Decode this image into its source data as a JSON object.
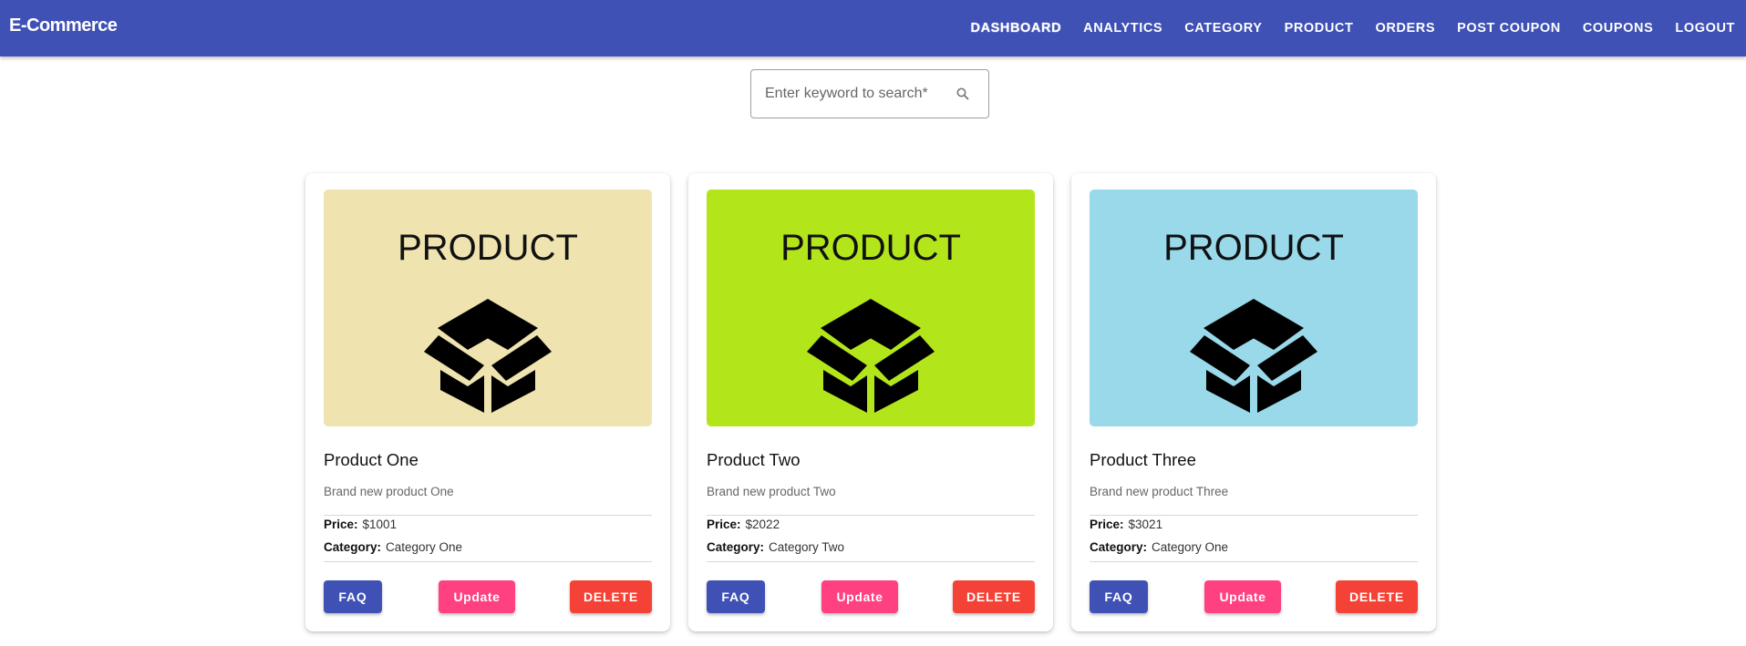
{
  "app": {
    "title": "E-Commerce"
  },
  "nav": {
    "items": [
      {
        "label": "DASHBOARD",
        "active": true
      },
      {
        "label": "ANALYTICS"
      },
      {
        "label": "CATEGORY"
      },
      {
        "label": "PRODUCT"
      },
      {
        "label": "ORDERS"
      },
      {
        "label": "POST COUPON"
      },
      {
        "label": "COUPONS"
      },
      {
        "label": "LOGOUT"
      }
    ]
  },
  "search": {
    "placeholder": "Enter keyword to search*",
    "value": "",
    "icon": "search-icon"
  },
  "labels": {
    "price": "Price:",
    "category": "Category:"
  },
  "products": [
    {
      "media_text": "PRODUCT",
      "media_bg": "#efe3b0",
      "name": "Product One",
      "description": "Brand new product One",
      "price": "$1001",
      "category": "Category One",
      "buttons": {
        "faq": "FAQ",
        "update": "Update",
        "delete": "DELETE"
      }
    },
    {
      "media_text": "PRODUCT",
      "media_bg": "#b3e61a",
      "name": "Product Two",
      "description": "Brand new product Two",
      "price": "$2022",
      "category": "Category Two",
      "buttons": {
        "faq": "FAQ",
        "update": "Update",
        "delete": "DELETE"
      }
    },
    {
      "media_text": "PRODUCT",
      "media_bg": "#99d9ea",
      "name": "Product Three",
      "description": "Brand new product Three",
      "price": "$3021",
      "category": "Category One",
      "buttons": {
        "faq": "FAQ",
        "update": "Update",
        "delete": "DELETE"
      }
    }
  ],
  "colors": {
    "primary": "#3f51b5",
    "update": "#ff4081",
    "delete": "#f44336"
  }
}
